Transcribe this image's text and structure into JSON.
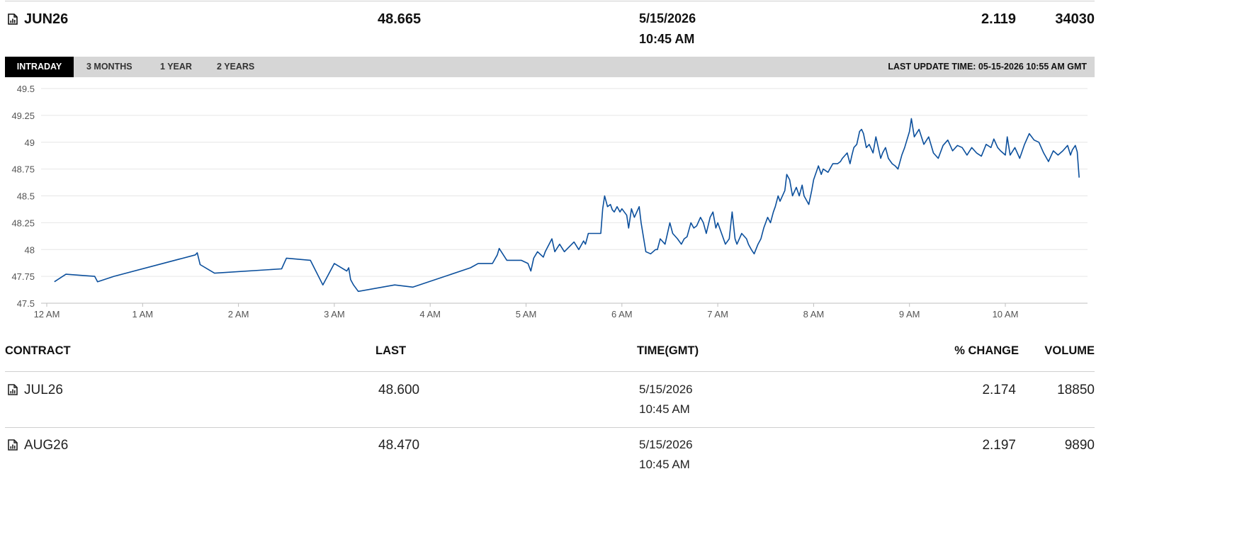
{
  "main": {
    "contract": "JUN26",
    "last": "48.665",
    "date": "5/15/2026",
    "time": "10:45 AM",
    "pct_change": "2.119",
    "volume": "34030"
  },
  "tabs": [
    {
      "label": "INTRADAY",
      "active": true
    },
    {
      "label": "3 MONTHS",
      "active": false
    },
    {
      "label": "1 YEAR",
      "active": false
    },
    {
      "label": "2 YEARS",
      "active": false
    }
  ],
  "last_update": "LAST UPDATE TIME: 05-15-2026 10:55 AM GMT",
  "chart_data": {
    "type": "line",
    "line_color": "#0b4f9c",
    "grid": true,
    "ylim": [
      47.5,
      49.5
    ],
    "yticks": [
      "49.5",
      "49.25",
      "49",
      "48.75",
      "48.5",
      "48.25",
      "48",
      "47.75",
      "47.5"
    ],
    "xticks": [
      "12 AM",
      "1 AM",
      "2 AM",
      "3 AM",
      "4 AM",
      "5 AM",
      "6 AM",
      "7 AM",
      "8 AM",
      "9 AM",
      "10 AM"
    ],
    "series": [
      {
        "x_hours": [
          0.08,
          0.2,
          0.5,
          0.53,
          0.7,
          1.55,
          1.57,
          1.6,
          1.75,
          2.45,
          2.5,
          2.75,
          2.88,
          3.0,
          3.13,
          3.15,
          3.17,
          3.2,
          3.25,
          3.63,
          3.82,
          4.42,
          4.5,
          4.65,
          4.7,
          4.72,
          4.8,
          4.95,
          5.02,
          5.05,
          5.08,
          5.12,
          5.18,
          5.2,
          5.27,
          5.3,
          5.35,
          5.4,
          5.5,
          5.55,
          5.6,
          5.62,
          5.65,
          5.73,
          5.75,
          5.78,
          5.8,
          5.82,
          5.85,
          5.88,
          5.9,
          5.92,
          5.95,
          5.98,
          6.0,
          6.05,
          6.07,
          6.1,
          6.13,
          6.18,
          6.2,
          6.25,
          6.3,
          6.35,
          6.37,
          6.4,
          6.45,
          6.5,
          6.53,
          6.58,
          6.62,
          6.65,
          6.68,
          6.72,
          6.75,
          6.78,
          6.82,
          6.85,
          6.88,
          6.92,
          6.95,
          6.98,
          7.0,
          7.08,
          7.12,
          7.15,
          7.18,
          7.2,
          7.25,
          7.3,
          7.32,
          7.35,
          7.38,
          7.42,
          7.45,
          7.48,
          7.52,
          7.55,
          7.58,
          7.6,
          7.63,
          7.65,
          7.7,
          7.72,
          7.75,
          7.78,
          7.82,
          7.85,
          7.88,
          7.9,
          7.95,
          7.98,
          8.0,
          8.05,
          8.08,
          8.1,
          8.15,
          8.2,
          8.25,
          8.28,
          8.3,
          8.35,
          8.38,
          8.4,
          8.42,
          8.45,
          8.48,
          8.5,
          8.52,
          8.55,
          8.58,
          8.62,
          8.65,
          8.7,
          8.72,
          8.75,
          8.78,
          8.82,
          8.85,
          8.88,
          8.92,
          8.95,
          9.0,
          9.02,
          9.05,
          9.1,
          9.15,
          9.2,
          9.25,
          9.3,
          9.35,
          9.4,
          9.45,
          9.5,
          9.55,
          9.6,
          9.65,
          9.7,
          9.75,
          9.8,
          9.85,
          9.88,
          9.92,
          9.95,
          10.0,
          10.02,
          10.05,
          10.1,
          10.15,
          10.2,
          10.25,
          10.3,
          10.35,
          10.4,
          10.45,
          10.5,
          10.55,
          10.6,
          10.65,
          10.68,
          10.7,
          10.73,
          10.75,
          10.77
        ],
        "y": [
          47.7,
          47.77,
          47.75,
          47.7,
          47.75,
          47.95,
          47.97,
          47.86,
          47.78,
          47.82,
          47.92,
          47.9,
          47.67,
          47.87,
          47.8,
          47.83,
          47.72,
          47.67,
          47.61,
          47.67,
          47.65,
          47.83,
          47.87,
          47.87,
          47.95,
          48.01,
          47.9,
          47.9,
          47.87,
          47.8,
          47.92,
          47.98,
          47.93,
          47.98,
          48.1,
          47.98,
          48.05,
          47.98,
          48.07,
          48.0,
          48.08,
          48.05,
          48.15,
          48.15,
          48.15,
          48.15,
          48.38,
          48.5,
          48.4,
          48.42,
          48.37,
          48.35,
          48.4,
          48.35,
          48.38,
          48.32,
          48.2,
          48.38,
          48.3,
          48.4,
          48.25,
          47.98,
          47.96,
          48.0,
          48.0,
          48.1,
          48.05,
          48.25,
          48.15,
          48.1,
          48.05,
          48.1,
          48.12,
          48.25,
          48.2,
          48.22,
          48.3,
          48.25,
          48.15,
          48.3,
          48.35,
          48.2,
          48.25,
          48.05,
          48.1,
          48.35,
          48.1,
          48.05,
          48.15,
          48.1,
          48.05,
          48.0,
          47.96,
          48.05,
          48.1,
          48.2,
          48.3,
          48.25,
          48.35,
          48.4,
          48.5,
          48.45,
          48.55,
          48.7,
          48.65,
          48.5,
          48.58,
          48.5,
          48.6,
          48.5,
          48.42,
          48.55,
          48.65,
          48.78,
          48.7,
          48.75,
          48.72,
          48.8,
          48.8,
          48.82,
          48.85,
          48.9,
          48.8,
          48.88,
          48.95,
          48.98,
          49.1,
          49.12,
          49.08,
          48.95,
          48.98,
          48.9,
          49.05,
          48.85,
          48.9,
          48.95,
          48.85,
          48.8,
          48.78,
          48.75,
          48.88,
          48.95,
          49.1,
          49.22,
          49.05,
          49.12,
          48.98,
          49.05,
          48.9,
          48.85,
          48.97,
          49.02,
          48.92,
          48.97,
          48.95,
          48.88,
          48.95,
          48.9,
          48.87,
          48.98,
          48.95,
          49.03,
          48.95,
          48.92,
          48.88,
          49.05,
          48.88,
          48.95,
          48.85,
          48.98,
          49.08,
          49.02,
          49.0,
          48.9,
          48.82,
          48.92,
          48.88,
          48.92,
          48.97,
          48.88,
          48.93,
          48.97,
          48.91,
          48.67,
          48.68
        ]
      }
    ]
  },
  "table": {
    "headers": {
      "contract": "CONTRACT",
      "last": "LAST",
      "time": "TIME(GMT)",
      "pct_change": "% CHANGE",
      "volume": "VOLUME"
    },
    "rows": [
      {
        "contract": "JUL26",
        "last": "48.600",
        "date": "5/15/2026",
        "time": "10:45 AM",
        "pct_change": "2.174",
        "volume": "18850"
      },
      {
        "contract": "AUG26",
        "last": "48.470",
        "date": "5/15/2026",
        "time": "10:45 AM",
        "pct_change": "2.197",
        "volume": "9890"
      }
    ]
  }
}
